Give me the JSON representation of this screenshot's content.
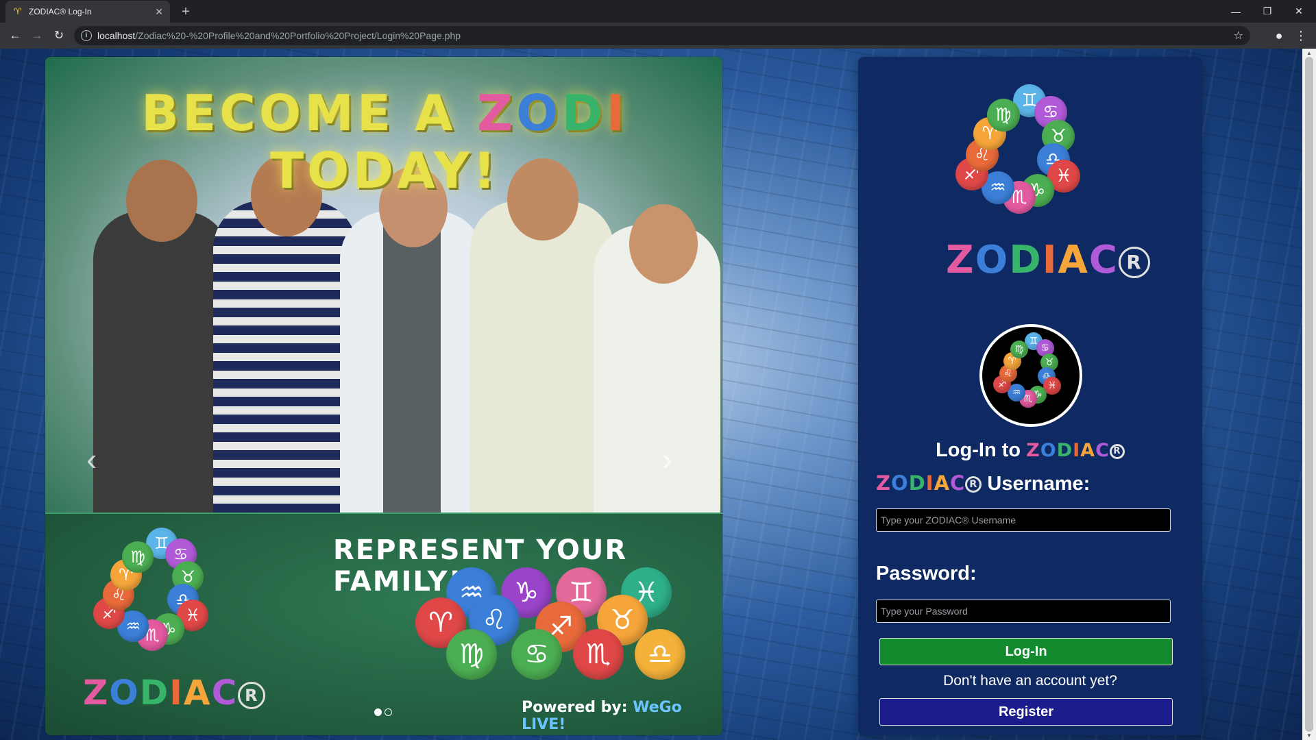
{
  "browser": {
    "tab_title": "ZODIAC® Log-In",
    "url_host": "localhost",
    "url_path": "/Zodiac%20-%20Profile%20and%20Portfolio%20Project/Login%20Page.php"
  },
  "promo": {
    "banner_prefix": "BECOME A ",
    "banner_zodi": [
      "Z",
      "O",
      "D",
      "I"
    ],
    "banner_suffix": " TODAY!",
    "tagline": "REPRESENT YOUR FAMILY!",
    "powered_prefix": "Powered by: ",
    "powered_brand": "WeGo LIVE!",
    "signs": [
      "♒",
      "♑",
      "♊",
      "♓",
      "♈",
      "♌",
      "♐",
      "♉",
      "♍",
      "♋",
      "♏",
      "♎"
    ],
    "sign_colors": [
      "#3b7fd8",
      "#9a45c9",
      "#e36a9a",
      "#2fb08a",
      "#e04848",
      "#3b7fd8",
      "#e86a3a",
      "#f5a53a",
      "#4cae52",
      "#4cae52",
      "#e04848",
      "#f5b23a"
    ],
    "slides": 2,
    "active_slide": 1
  },
  "logo": {
    "wordmark": [
      "Z",
      "O",
      "D",
      "I",
      "A",
      "C"
    ],
    "registered": "R",
    "ring_signs": [
      "♊",
      "♋",
      "♉",
      "♎",
      "♓",
      "♑",
      "♏",
      "♒",
      "♐",
      "♌",
      "♈",
      "♍"
    ]
  },
  "login": {
    "heading_prefix": "Log-In to ",
    "username_label": "Username:",
    "username_placeholder": "Type your ZODIAC® Username",
    "password_label": "Password:",
    "password_placeholder": "Type your Password",
    "login_button": "Log-In",
    "no_account_text": "Don't have an account yet?",
    "register_button": "Register"
  },
  "colors": {
    "panel_bg": "#0f2a63",
    "login_button": "#138a2e",
    "register_button": "#1c1c8c"
  }
}
